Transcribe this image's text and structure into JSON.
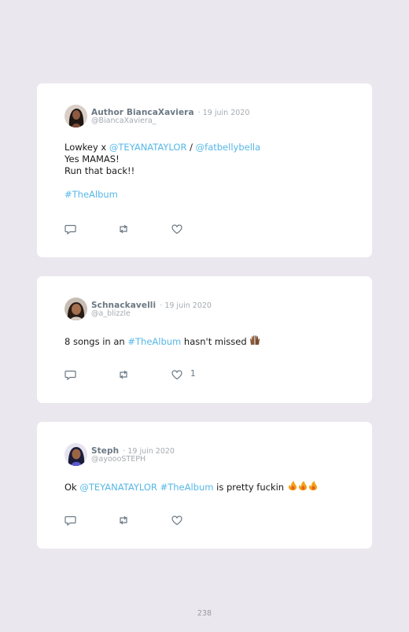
{
  "tweets": [
    {
      "name": "Author BiancaXaviera",
      "date": "· 19 juin 2020",
      "handle": "@BiancaXaviera_",
      "line1_pre": "Lowkey x ",
      "line1_link1": "@TEYANATAYLOR",
      "line1_mid": " / ",
      "line1_link2": "@fatbellybella",
      "line2": "Yes MAMAS!",
      "line3": "Run that back!!",
      "hashtag": "#TheAlbum",
      "likes": ""
    },
    {
      "name": "Schnackavelli",
      "date": "· 19 juin 2020",
      "handle": "@a_blizzle",
      "text_pre": "8 songs in an ",
      "hashtag": "#TheAlbum",
      "text_post": " hasn't missed ",
      "emoji": "raised-hands",
      "likes": "1"
    },
    {
      "name": "Steph",
      "date": "· 19 juin 2020",
      "handle": "@ayoooSTEPH",
      "text_pre": "Ok ",
      "mention": "@TEYANATAYLOR",
      "hashtag": "#TheAlbum",
      "text_post": " is pretty fuckin ",
      "emoji": "fire x3",
      "likes": ""
    }
  ],
  "icons": [
    "reply-icon",
    "retweet-icon",
    "like-icon"
  ],
  "colors": {
    "link": "#56b7e6",
    "background": "#ebe7ee",
    "card": "#ffffff"
  },
  "page_number": "238"
}
